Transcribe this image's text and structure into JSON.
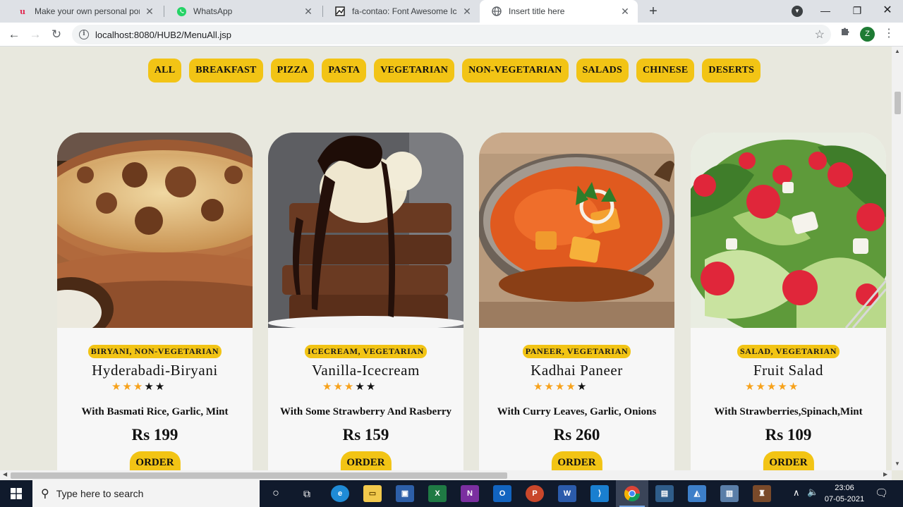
{
  "browser": {
    "tabs": [
      {
        "title": "Make your own personal portfoli",
        "icon": "unacademy-icon",
        "active": false
      },
      {
        "title": "WhatsApp",
        "icon": "whatsapp-icon",
        "active": false
      },
      {
        "title": "fa-contao: Font Awesome Icons",
        "icon": "font-awesome-icon",
        "active": false
      },
      {
        "title": "Insert title here",
        "icon": "globe-icon",
        "active": true
      }
    ],
    "url": "localhost:8080/HUB2/MenuAll.jsp",
    "profile_initial": "Z"
  },
  "filters": [
    "ALL",
    "BREAKFAST",
    "PIZZA",
    "PASTA",
    "VEGETARIAN",
    "NON-VEGETARIAN",
    "SALADS",
    "CHINESE",
    "DESERTS"
  ],
  "menu": [
    {
      "tags": "BIRYANI, NON-VEGETARIAN",
      "name": "Hyderabadi-Biryani",
      "rating": 3,
      "description": "With Basmati Rice, Garlic, Mint",
      "price": "Rs 199",
      "order_label": "ORDER"
    },
    {
      "tags": "ICECREAM, VEGETARIAN",
      "name": "Vanilla-Icecream",
      "rating": 3,
      "description": "With Some Strawberry And Rasberry",
      "price": "Rs 159",
      "order_label": "ORDER"
    },
    {
      "tags": "PANEER, VEGETARIAN",
      "name": "Kadhai Paneer",
      "rating": 4,
      "description": "With Curry Leaves, Garlic, Onions",
      "price": "Rs 260",
      "order_label": "ORDER"
    },
    {
      "tags": "SALAD, VEGETARIAN",
      "name": "Fruit Salad",
      "rating": 5,
      "description": "With Strawberries,Spinach,Mint",
      "price": "Rs 109",
      "order_label": "ORDER"
    }
  ],
  "rating_max": 5,
  "colors": {
    "accent": "#f2c415",
    "star": "#f7a21b",
    "page_bg": "#e8e8de"
  },
  "taskbar": {
    "search_placeholder": "Type here to search",
    "time": "23:06",
    "date": "07-05-2021"
  }
}
